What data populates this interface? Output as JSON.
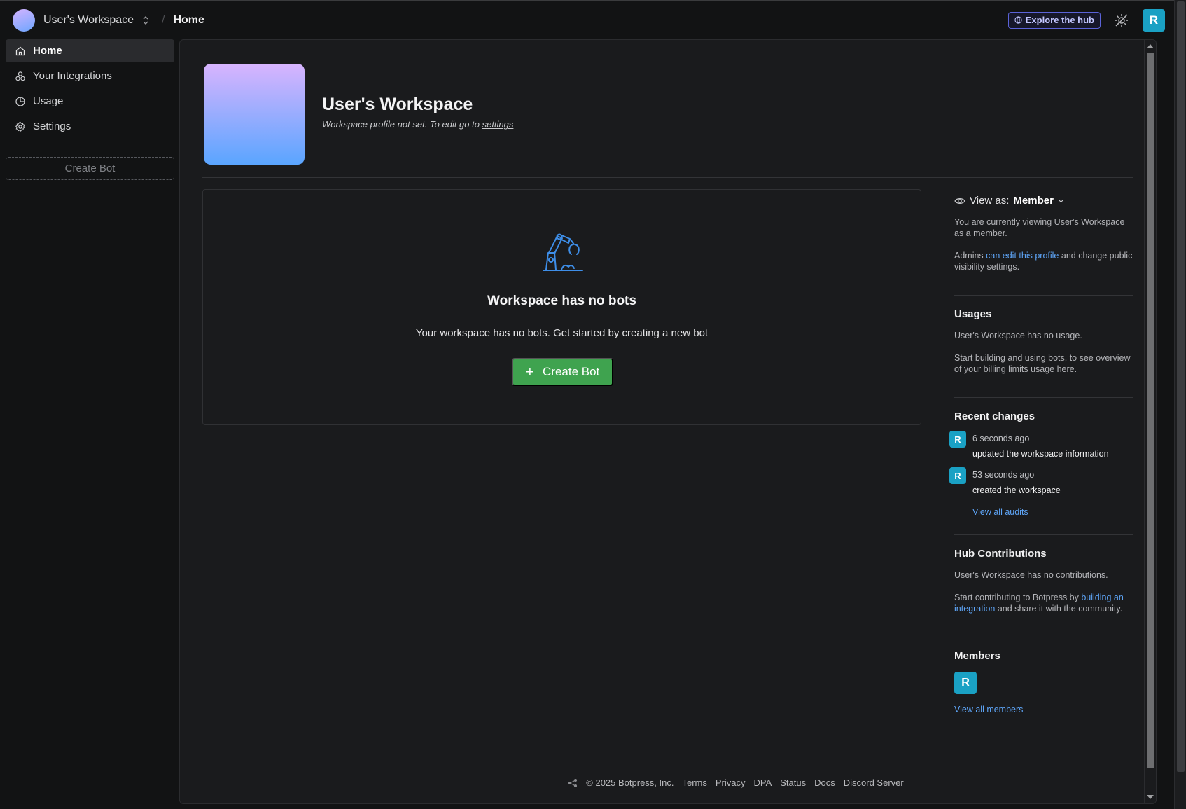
{
  "topbar": {
    "workspace_name": "User's Workspace",
    "breadcrumb_separator": "/",
    "breadcrumb_current": "Home",
    "explore_label": "Explore the hub",
    "user_initial": "R"
  },
  "sidebar": {
    "items": [
      {
        "label": "Home",
        "icon": "home-icon",
        "active": true
      },
      {
        "label": "Your Integrations",
        "icon": "integrations-icon",
        "active": false
      },
      {
        "label": "Usage",
        "icon": "usage-icon",
        "active": false
      },
      {
        "label": "Settings",
        "icon": "gear-icon",
        "active": false
      }
    ],
    "create_bot_label": "Create Bot"
  },
  "profile": {
    "title": "User's Workspace",
    "subtitle_prefix": "Workspace profile not set. To edit go to ",
    "subtitle_link": "settings"
  },
  "empty_state": {
    "title": "Workspace has no bots",
    "text": "Your workspace has no bots. Get started by creating a new bot",
    "button_label": "Create Bot",
    "button_icon": "+"
  },
  "aside": {
    "view_as_label": "View as:",
    "view_as_value": "Member",
    "viewing_text": "You are currently viewing User's Workspace as a member.",
    "admins_prefix": "Admins ",
    "admins_link": "can edit this profile",
    "admins_suffix": " and change public visibility settings.",
    "usages_title": "Usages",
    "usages_text_1": "User's Workspace has no usage.",
    "usages_text_2": "Start building and using bots, to see overview of your billing limits usage here.",
    "recent_title": "Recent changes",
    "changes": [
      {
        "initial": "R",
        "time": "6 seconds ago",
        "what": "updated the workspace information"
      },
      {
        "initial": "R",
        "time": "53 seconds ago",
        "what": "created the workspace"
      }
    ],
    "view_audits": "View all audits",
    "hub_title": "Hub Contributions",
    "hub_text_1": "User's Workspace has no contributions.",
    "hub_prefix": "Start contributing to Botpress by ",
    "hub_link": "building an integration",
    "hub_suffix": " and share it with the community.",
    "members_title": "Members",
    "member_initial": "R",
    "view_members": "View all members"
  },
  "footer": {
    "copyright": "© 2025 Botpress, Inc.",
    "links": [
      "Terms",
      "Privacy",
      "DPA",
      "Status",
      "Docs",
      "Discord Server"
    ]
  },
  "colors": {
    "accent_green": "#3fa34f",
    "avatar_teal": "#1aa1c4",
    "link_blue": "#5ea5f7",
    "hub_purple": "#5b63d8"
  }
}
